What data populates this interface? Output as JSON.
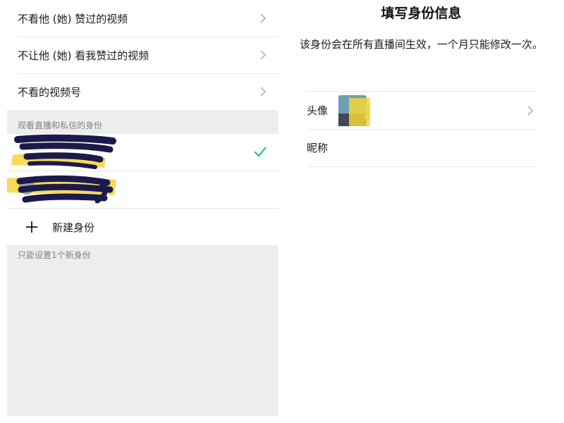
{
  "left_panel": {
    "settings": [
      {
        "label": "不看他 (她) 赞过的视频"
      },
      {
        "label": "不让他 (她) 看我赞过的视频"
      },
      {
        "label": "不看的视频号"
      }
    ],
    "section_header": "观看直播和私信的身份",
    "identities": [
      {
        "selected": true
      },
      {
        "selected": false
      }
    ],
    "new_identity_label": "新建身份",
    "footnote": "只能设置1个新身份"
  },
  "right_panel": {
    "title": "填写身份信息",
    "description": "该身份会在所有直播间生效，一个月只能修改一次。",
    "rows": {
      "avatar_label": "头像",
      "nickname_label": "昵称"
    }
  },
  "colors": {
    "panel_gray": "#ededed",
    "check_green": "#07c160",
    "chevron_gray": "#b2b2b2",
    "secondary_text": "#808080",
    "highlighter_yellow": "#f5d33b",
    "scribble_navy": "#1c1a4a"
  }
}
